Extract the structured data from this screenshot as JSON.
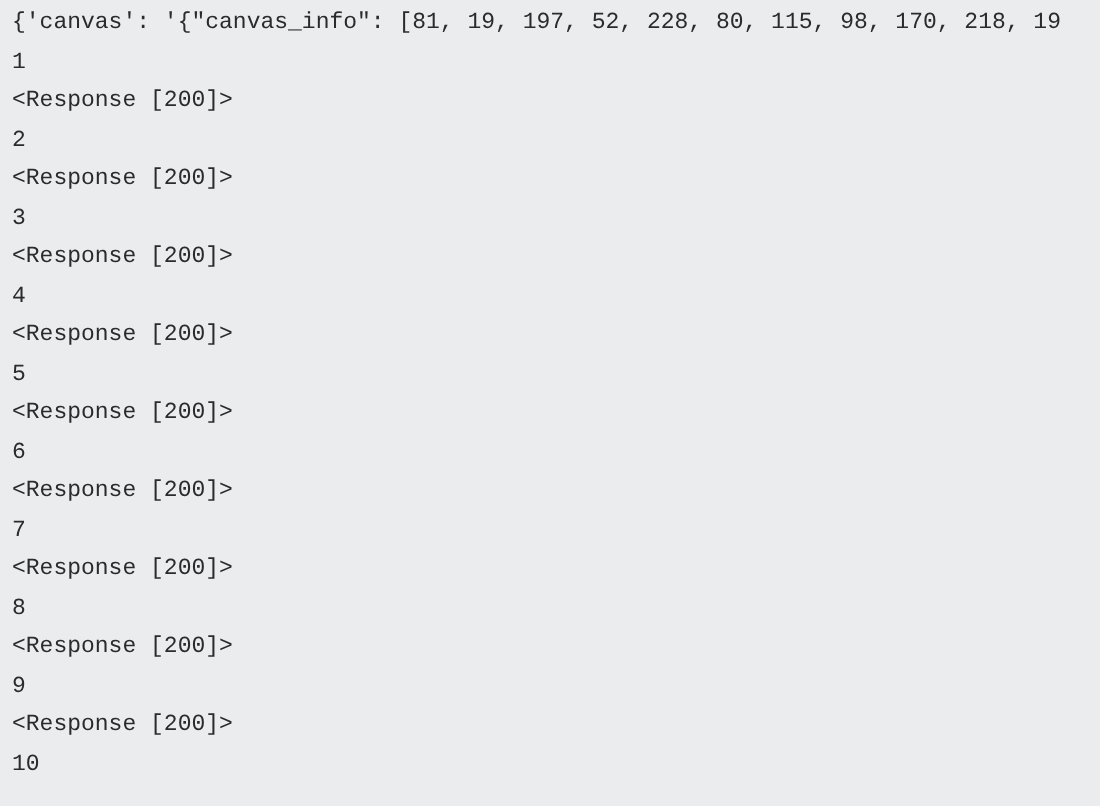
{
  "console": {
    "lines": [
      "{'canvas': '{\"canvas_info\": [81, 19, 197, 52, 228, 80, 115, 98, 170, 218, 19",
      "1",
      "<Response [200]>",
      "2",
      "<Response [200]>",
      "3",
      "<Response [200]>",
      "4",
      "<Response [200]>",
      "5",
      "<Response [200]>",
      "6",
      "<Response [200]>",
      "7",
      "<Response [200]>",
      "8",
      "<Response [200]>",
      "9",
      "<Response [200]>",
      "10"
    ]
  }
}
